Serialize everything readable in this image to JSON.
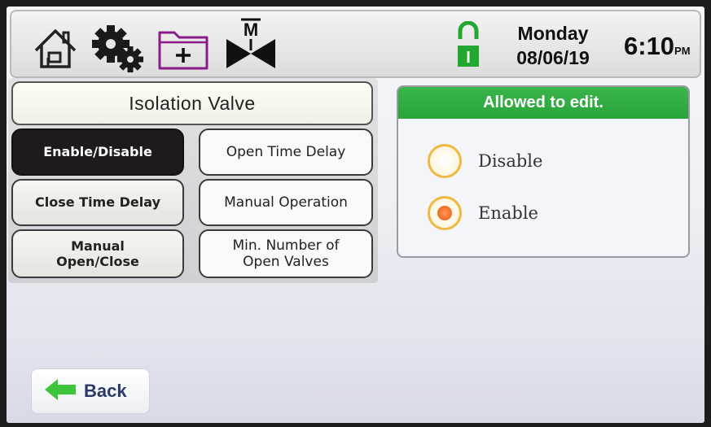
{
  "header": {
    "icons": [
      "home-icon",
      "gear-icon",
      "add-folder-icon",
      "manual-valve-icon",
      "lock-icon"
    ],
    "manual_valve_letter": "M",
    "lock_letter": "I",
    "day": "Monday",
    "date": "08/06/19",
    "time": "6:10",
    "ampm": "PM"
  },
  "title": "Isolation Valve",
  "menu": {
    "enable_disable": "Enable/Disable",
    "open_time_delay": "Open Time Delay",
    "close_time_delay": "Close Time Delay",
    "manual_operation": "Manual Operation",
    "manual_open_close_1": "Manual",
    "manual_open_close_2": "Open/Close",
    "min_open_valves_1": "Min. Number of",
    "min_open_valves_2": "Open Valves"
  },
  "edit_panel": {
    "header": "Allowed to edit.",
    "options": [
      {
        "label": "Disable",
        "selected": false
      },
      {
        "label": "Enable",
        "selected": true
      }
    ]
  },
  "back_label": "Back",
  "colors": {
    "accent_green": "#2aa43b",
    "radio_ring": "#f0b840",
    "radio_fill": "#f4661f",
    "active_button": "#1f1b1b"
  }
}
